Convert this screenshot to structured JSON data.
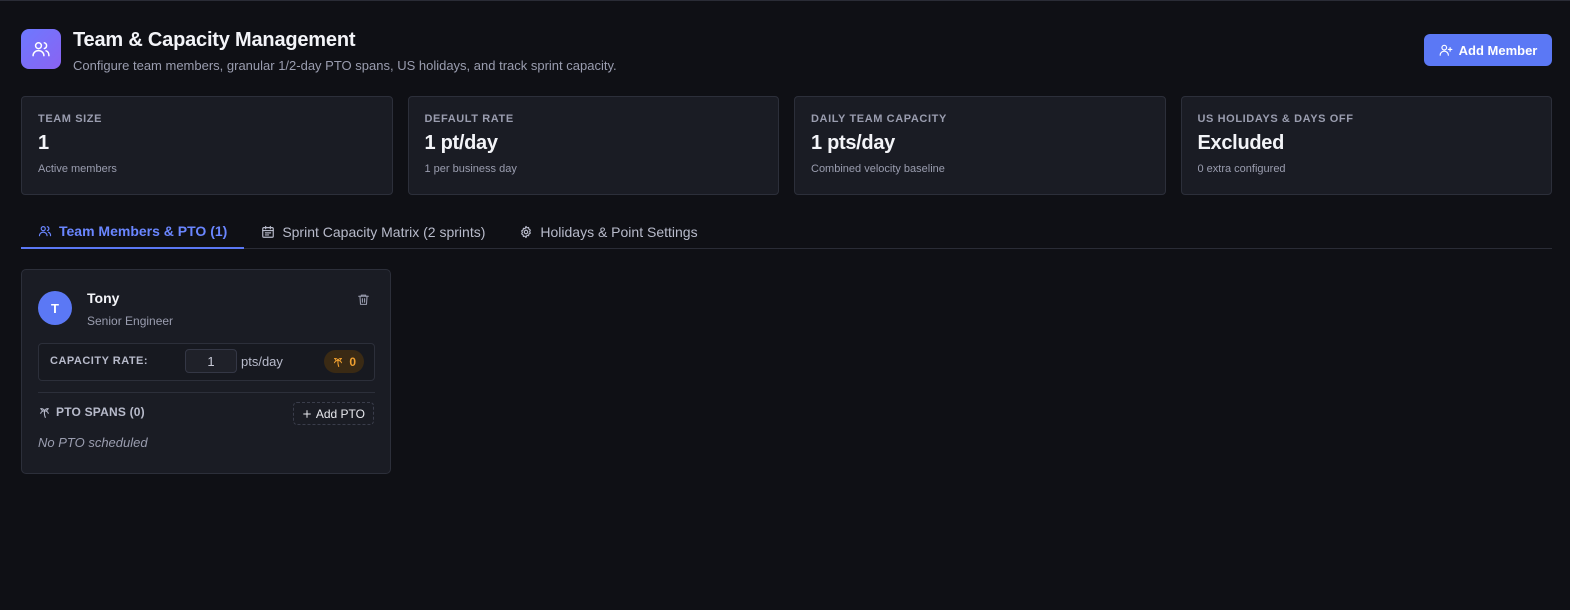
{
  "header": {
    "title": "Team & Capacity Management",
    "subtitle": "Configure team members, granular 1/2-day PTO spans, US holidays, and track sprint capacity.",
    "add_member_label": "Add Member",
    "logo_icon": "users-icon",
    "accent": "#5b78f5"
  },
  "stats": [
    {
      "label": "TEAM SIZE",
      "value": "1",
      "sub": "Active members"
    },
    {
      "label": "DEFAULT RATE",
      "value": "1 pt/day",
      "sub": "1 per business day"
    },
    {
      "label": "DAILY TEAM CAPACITY",
      "value": "1 pts/day",
      "sub": "Combined velocity baseline"
    },
    {
      "label": "US HOLIDAYS & DAYS OFF",
      "value": "Excluded",
      "sub": "0 extra configured"
    }
  ],
  "tabs": [
    {
      "label": "Team Members & PTO (1)",
      "icon": "users-icon",
      "active": true
    },
    {
      "label": "Sprint Capacity Matrix (2 sprints)",
      "icon": "calendar-icon",
      "active": false
    },
    {
      "label": "Holidays & Point Settings",
      "icon": "gear-icon",
      "active": false
    }
  ],
  "member": {
    "initial": "T",
    "name": "Tony",
    "role": "Senior Engineer",
    "capacity_label": "CAPACITY RATE:",
    "capacity_value": "1",
    "capacity_unit": "pts/day",
    "pto_count": "0",
    "pto_header": "PTO SPANS (0)",
    "add_pto_label": "Add PTO",
    "no_pto_text": "No PTO scheduled",
    "avatar_color": "#5b78f5",
    "pto_badge_color": "#f0a030"
  }
}
